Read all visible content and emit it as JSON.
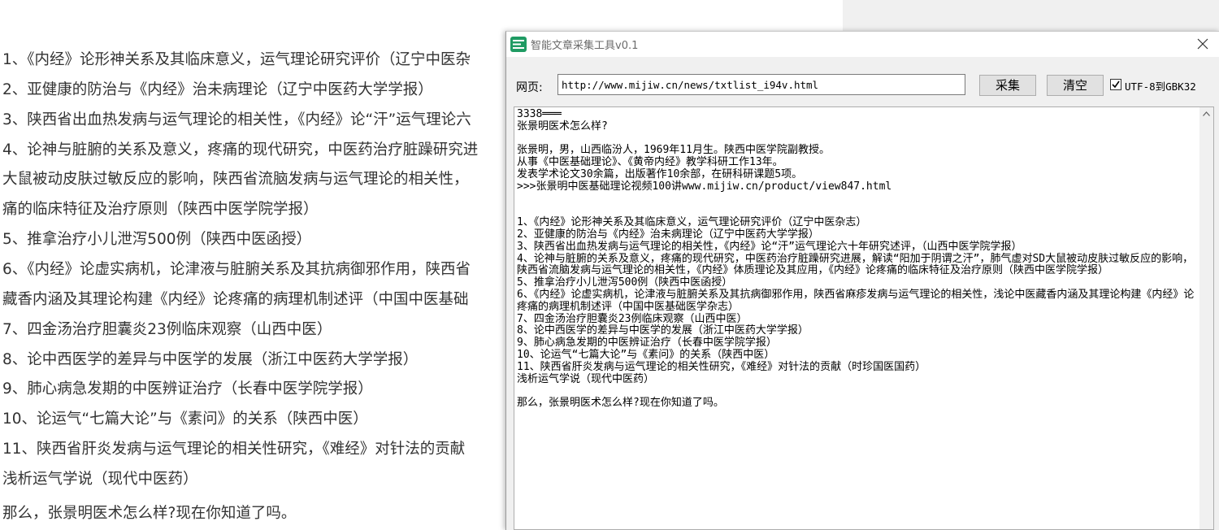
{
  "article": {
    "lines": [
      "1、《内经》论形神关系及其临床意义，运气理论研究评价（辽宁中医杂",
      "2、亚健康的防治与《内经》治未病理论（辽宁中医药大学学报）",
      "3、陕西省出血热发病与运气理论的相关性，《内经》论“汗”运气理论六",
      "4、论神与脏腑的关系及意义，疼痛的现代研究，中医药治疗脏躁研究进",
      "大鼠被动皮肤过敏反应的影响，陕西省流脑发病与运气理论的相关性，",
      "痛的临床特征及治疗原则（陕西中医学院学报）",
      "5、推拿治疗小儿泄泻500例（陕西中医函授）",
      "6、《内经》论虚实病机，论津液与脏腑关系及其抗病御邪作用，陕西省",
      "藏香内涵及其理论构建《内经》论疼痛的病理机制述评（中国中医基础",
      "7、四金汤治疗胆囊炎23例临床观察（山西中医）",
      "8、论中西医学的差异与中医学的发展（浙江中医药大学学报）",
      "9、肺心病急发期的中医辨证治疗（长春中医学院学报）",
      "10、论运气“七篇大论”与《素问》的关系（陕西中医）",
      "11、陕西省肝炎发病与运气理论的相关性研究，《难经》对针法的贡献",
      "浅析运气学说（现代中医药）",
      "那么，张景明医术怎么样?现在你知道了吗。"
    ]
  },
  "window": {
    "title": "智能文章采集工具v0.1",
    "url_label": "网页:",
    "url_value": "http://www.mijiw.cn/news/txtlist_i94v.html",
    "collect_label": "采集",
    "clear_label": "清空",
    "encoding_label": "UTF-8到GBK32",
    "encoding_checked": true,
    "output_text": "3338═══\n张景明医术怎么样?\n\n张景明，男，山西临汾人，1969年11月生。陕西中医学院副教授。\n从事《中医基础理论》、《黄帝内经》教学科研工作13年。\n发表学术论文30余篇，出版著作10余部，在研科研课题5项。\n>>>张景明中医基础理论视频100讲www.mijiw.cn/product/view847.html\n\n\n1、《内经》论形神关系及其临床意义，运气理论研究评价（辽宁中医杂志）\n2、亚健康的防治与《内经》治未病理论（辽宁中医药大学学报）\n3、陕西省出血热发病与运气理论的相关性，《内经》论“汗”运气理论六十年研究述评，（山西中医学院学报）\n4、论神与脏腑的关系及意义，疼痛的现代研究，中医药治疗脏躁研究进展，解读“阳加于阴谓之汗”，肺气虚对SD大鼠被动皮肤过敏反应的影响，陕西省流脑发病与运气理论的相关性，《内经》体质理论及其应用，《内经》论疼痛的临床特征及治疗原则（陕西中医学院学报）\n5、推拿治疗小儿泄泻500例（陕西中医函授）\n6、《内经》论虚实病机，论津液与脏腑关系及其抗病御邪作用，陕西省麻疹发病与运气理论的相关性，浅论中医藏香内涵及其理论构建《内经》论疼痛的病理机制述评（中国中医基础医学杂志）\n7、四金汤治疗胆囊炎23例临床观察（山西中医）\n8、论中西医学的差异与中医学的发展（浙江中医药大学学报）\n9、肺心病急发期的中医辨证治疗（长春中医学院学报）\n10、论运气“七篇大论”与《素问》的关系（陕西中医）\n11、陕西省肝炎发病与运气理论的相关性研究，《难经》对针法的贡献（时珍国医国药）\n浅析运气学说（现代中医药）\n\n那么，张景明医术怎么样?现在你知道了吗。"
  },
  "colors": {
    "accent_icon": "#1f9b63",
    "window_bg": "#f0f0f0"
  }
}
